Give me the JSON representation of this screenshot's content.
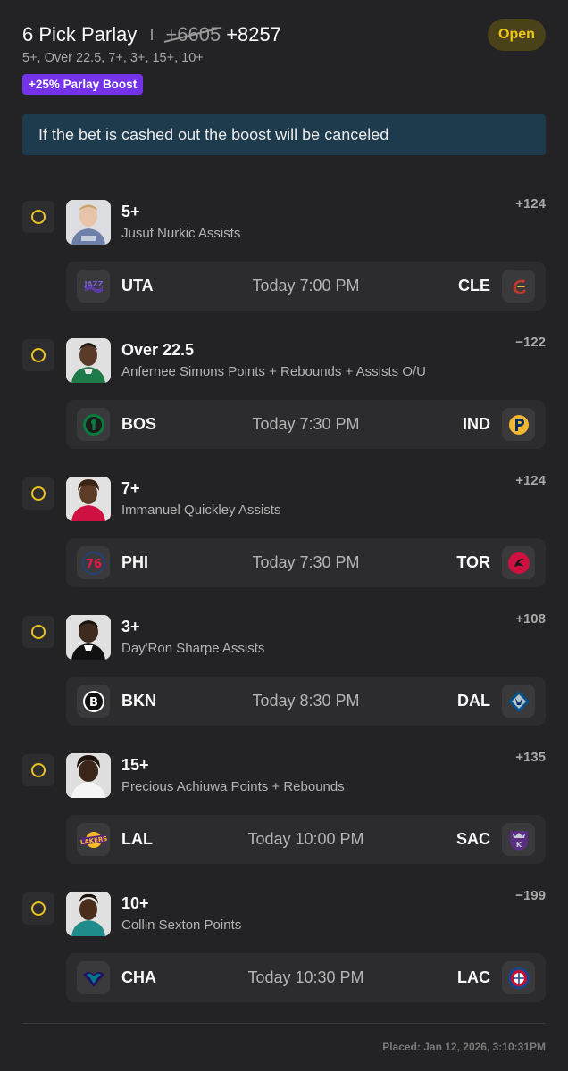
{
  "header": {
    "title": "6 Pick Parlay",
    "old_odds": "+6605",
    "new_odds": "+8257",
    "status": "Open",
    "subtitle": "5+, Over 22.5, 7+, 3+, 15+, 10+",
    "boost_label": "+25% Parlay Boost"
  },
  "info_message": "If the bet is cashed out the boost will be canceled",
  "picks": [
    {
      "line": "5+",
      "description": "Jusuf Nurkic Assists",
      "odds": "+124",
      "away": "UTA",
      "home": "CLE",
      "time": "Today 7:00 PM",
      "away_logo": "jazz-logo-icon",
      "home_logo": "cavaliers-logo-icon"
    },
    {
      "line": "Over 22.5",
      "description": "Anfernee Simons Points + Rebounds + Assists O/U",
      "odds": "−122",
      "away": "BOS",
      "home": "IND",
      "time": "Today 7:30 PM",
      "away_logo": "celtics-logo-icon",
      "home_logo": "pacers-logo-icon"
    },
    {
      "line": "7+",
      "description": "Immanuel Quickley Assists",
      "odds": "+124",
      "away": "PHI",
      "home": "TOR",
      "time": "Today 7:30 PM",
      "away_logo": "76ers-logo-icon",
      "home_logo": "raptors-logo-icon"
    },
    {
      "line": "3+",
      "description": "Day'Ron Sharpe Assists",
      "odds": "+108",
      "away": "BKN",
      "home": "DAL",
      "time": "Today 8:30 PM",
      "away_logo": "nets-logo-icon",
      "home_logo": "mavericks-logo-icon"
    },
    {
      "line": "15+",
      "description": "Precious Achiuwa Points + Rebounds",
      "odds": "+135",
      "away": "LAL",
      "home": "SAC",
      "time": "Today 10:00 PM",
      "away_logo": "lakers-logo-icon",
      "home_logo": "kings-logo-icon"
    },
    {
      "line": "10+",
      "description": "Collin Sexton Points",
      "odds": "−199",
      "away": "CHA",
      "home": "LAC",
      "time": "Today 10:30 PM",
      "away_logo": "hornets-logo-icon",
      "home_logo": "clippers-logo-icon"
    }
  ],
  "footer": {
    "placed": "Placed: Jan 12, 2026, 3:10:31PM"
  },
  "colors": {
    "background": "#232325",
    "card": "#2c2c2e",
    "accent_yellow": "#f0c419",
    "boost_purple": "#7433e8",
    "info_blue": "#1e3a4d"
  }
}
